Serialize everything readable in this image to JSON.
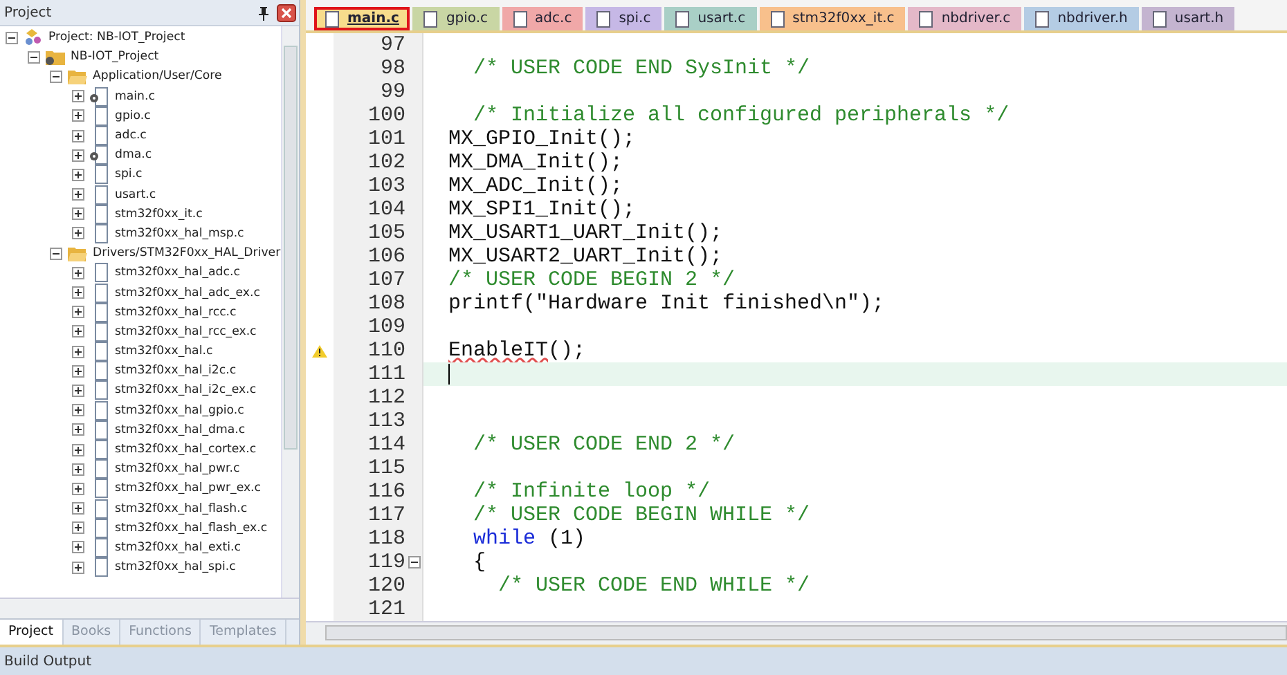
{
  "project_panel": {
    "title": "Project",
    "tree": [
      {
        "label": "Project: NB-IOT_Project",
        "kind": "project",
        "expanded": true,
        "children": [
          {
            "label": "NB-IOT_Project",
            "kind": "target",
            "expanded": true,
            "children": [
              {
                "label": "Application/User/Core",
                "kind": "folder",
                "expanded": true,
                "children": [
                  {
                    "label": "main.c",
                    "kind": "config",
                    "expanded": false
                  },
                  {
                    "label": "gpio.c",
                    "kind": "file",
                    "expanded": false
                  },
                  {
                    "label": "adc.c",
                    "kind": "file",
                    "expanded": false
                  },
                  {
                    "label": "dma.c",
                    "kind": "config",
                    "expanded": false
                  },
                  {
                    "label": "spi.c",
                    "kind": "file",
                    "expanded": false
                  },
                  {
                    "label": "usart.c",
                    "kind": "file",
                    "expanded": false
                  },
                  {
                    "label": "stm32f0xx_it.c",
                    "kind": "file",
                    "expanded": false
                  },
                  {
                    "label": "stm32f0xx_hal_msp.c",
                    "kind": "file",
                    "expanded": false
                  }
                ]
              },
              {
                "label": "Drivers/STM32F0xx_HAL_Driver",
                "kind": "folder",
                "expanded": true,
                "children": [
                  {
                    "label": "stm32f0xx_hal_adc.c",
                    "kind": "file",
                    "expanded": false
                  },
                  {
                    "label": "stm32f0xx_hal_adc_ex.c",
                    "kind": "file",
                    "expanded": false
                  },
                  {
                    "label": "stm32f0xx_hal_rcc.c",
                    "kind": "file",
                    "expanded": false
                  },
                  {
                    "label": "stm32f0xx_hal_rcc_ex.c",
                    "kind": "file",
                    "expanded": false
                  },
                  {
                    "label": "stm32f0xx_hal.c",
                    "kind": "file",
                    "expanded": false
                  },
                  {
                    "label": "stm32f0xx_hal_i2c.c",
                    "kind": "file",
                    "expanded": false
                  },
                  {
                    "label": "stm32f0xx_hal_i2c_ex.c",
                    "kind": "file",
                    "expanded": false
                  },
                  {
                    "label": "stm32f0xx_hal_gpio.c",
                    "kind": "file",
                    "expanded": false
                  },
                  {
                    "label": "stm32f0xx_hal_dma.c",
                    "kind": "file",
                    "expanded": false
                  },
                  {
                    "label": "stm32f0xx_hal_cortex.c",
                    "kind": "file",
                    "expanded": false
                  },
                  {
                    "label": "stm32f0xx_hal_pwr.c",
                    "kind": "file",
                    "expanded": false
                  },
                  {
                    "label": "stm32f0xx_hal_pwr_ex.c",
                    "kind": "file",
                    "expanded": false
                  },
                  {
                    "label": "stm32f0xx_hal_flash.c",
                    "kind": "file",
                    "expanded": false
                  },
                  {
                    "label": "stm32f0xx_hal_flash_ex.c",
                    "kind": "file",
                    "expanded": false
                  },
                  {
                    "label": "stm32f0xx_hal_exti.c",
                    "kind": "file",
                    "expanded": false
                  },
                  {
                    "label": "stm32f0xx_hal_spi.c",
                    "kind": "file",
                    "expanded": false
                  }
                ]
              }
            ]
          }
        ]
      }
    ],
    "tabs": [
      {
        "label": "Project",
        "selected": true
      },
      {
        "label": "Books",
        "selected": false
      },
      {
        "label": "Functions",
        "selected": false
      },
      {
        "label": "Templates",
        "selected": false
      }
    ]
  },
  "editor_tabs": [
    {
      "label": "main.c",
      "color": "#f7dc8c",
      "selected": true
    },
    {
      "label": "gpio.c",
      "color": "#c9d6a4",
      "selected": false
    },
    {
      "label": "adc.c",
      "color": "#f0a8a8",
      "selected": false
    },
    {
      "label": "spi.c",
      "color": "#c6b8e6",
      "selected": false
    },
    {
      "label": "usart.c",
      "color": "#a9cfc6",
      "selected": false
    },
    {
      "label": "stm32f0xx_it.c",
      "color": "#f8c08c",
      "selected": false
    },
    {
      "label": "nbdriver.c",
      "color": "#e4b8c8",
      "selected": false
    },
    {
      "label": "nbdriver.h",
      "color": "#b4cce4",
      "selected": false
    },
    {
      "label": "usart.h",
      "color": "#c4b4d0",
      "selected": false
    }
  ],
  "code_lines": [
    {
      "number": "97",
      "warning": false,
      "current": false,
      "fold": false
    },
    {
      "number": "98",
      "warning": false,
      "current": false,
      "fold": false,
      "segments": [
        {
          "text": "  /* USER CODE END SysInit */",
          "kind": "comment"
        }
      ]
    },
    {
      "number": "99",
      "warning": false,
      "current": false,
      "fold": false
    },
    {
      "number": "100",
      "warning": false,
      "current": false,
      "fold": false,
      "segments": [
        {
          "text": "  /* Initialize all configured peripherals */",
          "kind": "comment"
        }
      ]
    },
    {
      "number": "101",
      "warning": false,
      "current": false,
      "fold": false,
      "segments": [
        {
          "text": "MX_GPIO_Init();",
          "kind": "code"
        }
      ]
    },
    {
      "number": "102",
      "warning": false,
      "current": false,
      "fold": false,
      "segments": [
        {
          "text": "MX_DMA_Init();",
          "kind": "code"
        }
      ]
    },
    {
      "number": "103",
      "warning": false,
      "current": false,
      "fold": false,
      "segments": [
        {
          "text": "MX_ADC_Init();",
          "kind": "code"
        }
      ]
    },
    {
      "number": "104",
      "warning": false,
      "current": false,
      "fold": false,
      "segments": [
        {
          "text": "MX_SPI1_Init();",
          "kind": "code"
        }
      ]
    },
    {
      "number": "105",
      "warning": false,
      "current": false,
      "fold": false,
      "segments": [
        {
          "text": "MX_USART1_UART_Init();",
          "kind": "code"
        }
      ]
    },
    {
      "number": "106",
      "warning": false,
      "current": false,
      "fold": false,
      "segments": [
        {
          "text": "MX_USART2_UART_Init();",
          "kind": "code"
        }
      ]
    },
    {
      "number": "107",
      "warning": false,
      "current": false,
      "fold": false,
      "segments": [
        {
          "text": "/* USER CODE BEGIN 2 */",
          "kind": "comment"
        }
      ]
    },
    {
      "number": "108",
      "warning": false,
      "current": false,
      "fold": false,
      "segments": [
        {
          "text": "printf(\"Hardware Init finished\\n\");",
          "kind": "code"
        }
      ]
    },
    {
      "number": "109",
      "warning": false,
      "current": false,
      "fold": false
    },
    {
      "number": "110",
      "warning": true,
      "current": false,
      "fold": false,
      "segments": [
        {
          "text": "EnableIT",
          "kind": "flagged"
        },
        {
          "text": "();",
          "kind": "code"
        }
      ]
    },
    {
      "number": "111",
      "warning": false,
      "current": true,
      "fold": false
    },
    {
      "number": "112",
      "warning": false,
      "current": false,
      "fold": false
    },
    {
      "number": "113",
      "warning": false,
      "current": false,
      "fold": false
    },
    {
      "number": "114",
      "warning": false,
      "current": false,
      "fold": false,
      "segments": [
        {
          "text": "  /* USER CODE END 2 */",
          "kind": "comment"
        }
      ]
    },
    {
      "number": "115",
      "warning": false,
      "current": false,
      "fold": false
    },
    {
      "number": "116",
      "warning": false,
      "current": false,
      "fold": false,
      "segments": [
        {
          "text": "  /* Infinite loop */",
          "kind": "comment"
        }
      ]
    },
    {
      "number": "117",
      "warning": false,
      "current": false,
      "fold": false,
      "segments": [
        {
          "text": "  /* USER CODE BEGIN WHILE */",
          "kind": "comment"
        }
      ]
    },
    {
      "number": "118",
      "warning": false,
      "current": false,
      "fold": false,
      "segments": [
        {
          "text": "  while",
          "kind": "keyword"
        },
        {
          "text": " (1)",
          "kind": "code"
        }
      ]
    },
    {
      "number": "119",
      "warning": false,
      "current": false,
      "fold": true,
      "segments": [
        {
          "text": "  {",
          "kind": "code"
        }
      ]
    },
    {
      "number": "120",
      "warning": false,
      "current": false,
      "fold": false,
      "segments": [
        {
          "text": "    /* USER CODE END WHILE */",
          "kind": "comment"
        }
      ]
    },
    {
      "number": "121",
      "warning": false,
      "current": false,
      "fold": false
    }
  ],
  "status_bar": {
    "title": "Build Output"
  }
}
